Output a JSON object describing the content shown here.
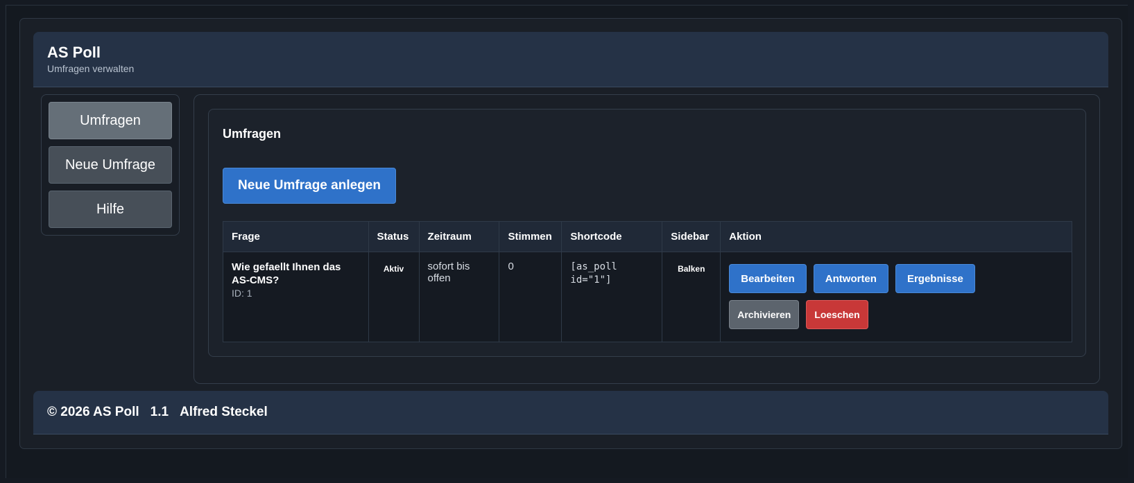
{
  "header": {
    "title": "AS Poll",
    "subtitle": "Umfragen verwalten"
  },
  "sidebar": {
    "items": [
      {
        "label": "Umfragen",
        "active": true
      },
      {
        "label": "Neue Umfrage",
        "active": false
      },
      {
        "label": "Hilfe",
        "active": false
      }
    ]
  },
  "main": {
    "card_title": "Umfragen",
    "new_button_label": "Neue Umfrage anlegen",
    "table": {
      "columns": [
        "Frage",
        "Status",
        "Zeitraum",
        "Stimmen",
        "Shortcode",
        "Sidebar",
        "Aktion"
      ],
      "rows": [
        {
          "question": "Wie gefaellt Ihnen das AS-CMS?",
          "id_label": "ID: 1",
          "status": "Aktiv",
          "period_line1": "sofort bis",
          "period_line2": "offen",
          "votes": "0",
          "shortcode_line1": "[as_poll",
          "shortcode_line2": "id=\"1\"]",
          "sidebar": "Balken",
          "actions": {
            "edit": "Bearbeiten",
            "answers": "Antworten",
            "results": "Ergebnisse",
            "archive": "Archivieren",
            "delete": "Loeschen"
          }
        }
      ]
    }
  },
  "footer": {
    "copyright": "© 2026 AS Poll",
    "version": "1.1",
    "author": "Alfred Steckel"
  },
  "colors": {
    "primary": "#2f72c9",
    "danger": "#c83838",
    "secondary": "#5c646d",
    "header_bg": "#253246",
    "page_bg": "#151a22"
  }
}
